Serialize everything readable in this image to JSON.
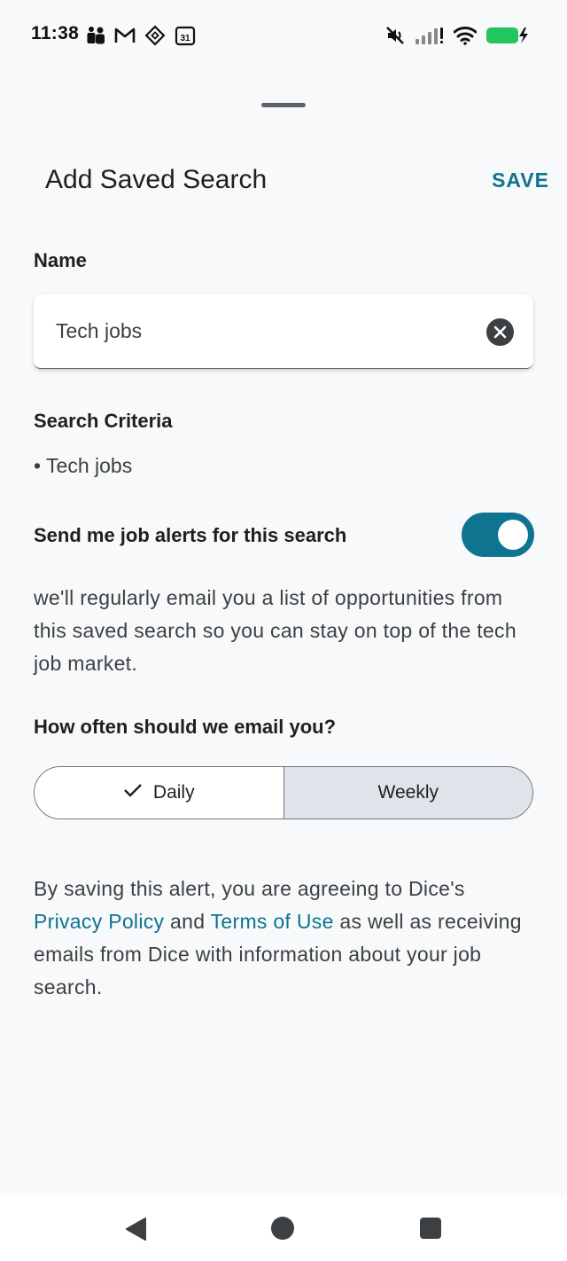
{
  "status_bar": {
    "time": "11:38",
    "left_icons": [
      "teams-icon",
      "gmail-icon",
      "app-diamond-icon",
      "calendar-icon"
    ],
    "calendar_day": "31",
    "right_icons": [
      "mute-icon",
      "signal-icon",
      "wifi-icon",
      "battery-charging-icon"
    ]
  },
  "sheet": {
    "title": "Add Saved Search",
    "save_label": "SAVE"
  },
  "name_section": {
    "label": "Name",
    "value": "Tech jobs"
  },
  "criteria_section": {
    "label": "Search Criteria",
    "items": [
      "• Tech jobs"
    ]
  },
  "alerts": {
    "label": "Send me job alerts for this search",
    "enabled": true,
    "description": "we'll regularly email you a list of opportunities from this saved search so you can stay on top of the tech job market."
  },
  "frequency": {
    "label": "How often should we email you?",
    "options": [
      "Daily",
      "Weekly"
    ],
    "selected": "Daily"
  },
  "consent": {
    "text_1": "By saving this alert, you are agreeing to Dice's ",
    "privacy_link": "Privacy Policy",
    "text_2": " and ",
    "terms_link": "Terms of Use",
    "text_3": " as well as receiving emails from Dice with information about your job search."
  },
  "colors": {
    "accent": "#0e7490",
    "selected_segment": "#dfe3ea",
    "background": "#f8f9fa"
  }
}
